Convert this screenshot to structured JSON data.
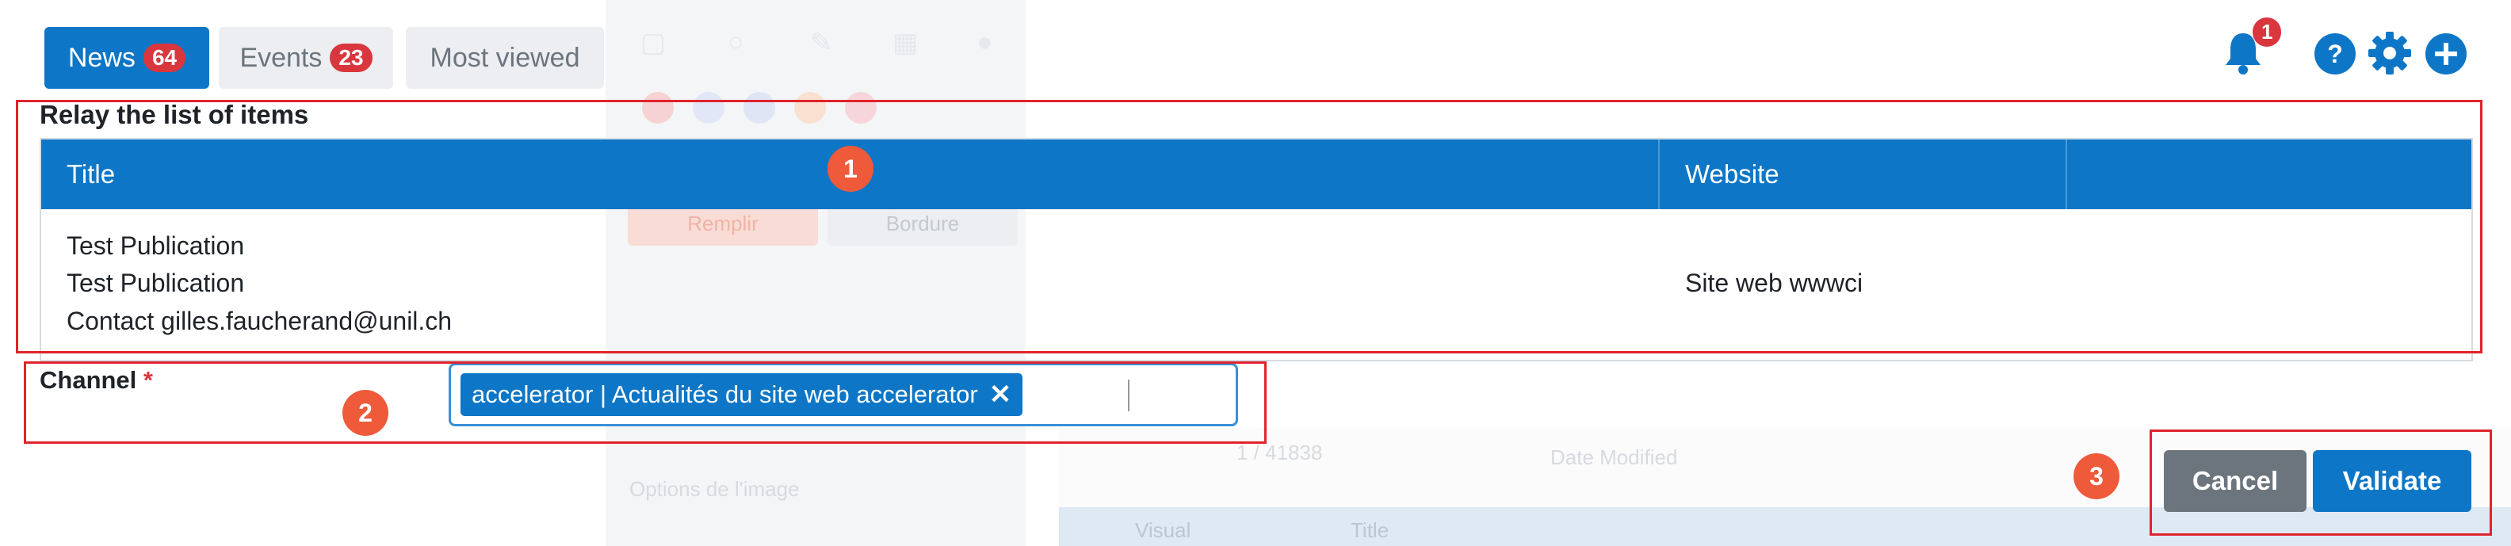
{
  "tabs": [
    {
      "label": "News",
      "count": "64"
    },
    {
      "label": "Events",
      "count": "23"
    },
    {
      "label": "Most viewed"
    }
  ],
  "header": {
    "notification_count": "1"
  },
  "relay": {
    "title": "Relay the list of items",
    "columns": [
      "Title",
      "Website",
      ""
    ],
    "row": {
      "title_lines": [
        "Test Publication",
        "Test Publication",
        "Contact gilles.faucherand@unil.ch"
      ],
      "website": "Site web wwwci"
    }
  },
  "channel": {
    "label": "Channel",
    "required_mark": "*",
    "selected": "accelerator | Actualités du site web accelerator"
  },
  "actions": {
    "cancel": "Cancel",
    "validate": "Validate"
  },
  "markers": [
    "1",
    "2",
    "3"
  ],
  "background": {
    "fill_label": "Remplir",
    "border_label": "Bordure",
    "image_options": "Options de l'image",
    "page_range": "1 / 41838",
    "sort": "Date Modified",
    "col_visual": "Visual",
    "col_title": "Title"
  },
  "colors": {
    "primary": "#0e76c6",
    "danger": "#d9363e",
    "annotation": "#e0242c",
    "marker": "#ef5a3a",
    "cancel": "#6c757d"
  }
}
